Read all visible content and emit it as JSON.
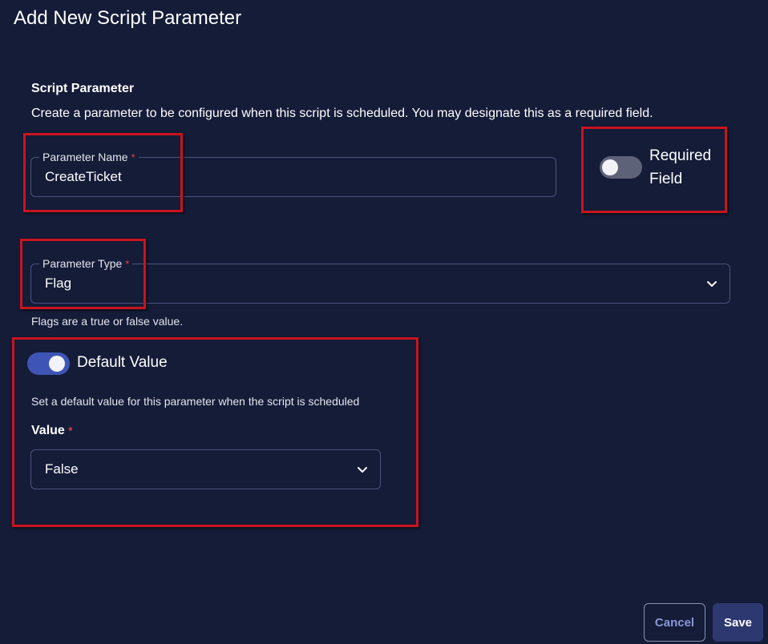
{
  "dialog": {
    "title": "Add New Script Parameter"
  },
  "section": {
    "title": "Script Parameter",
    "description": "Create a parameter to be configured when this script is scheduled. You may designate this as a required field."
  },
  "parameter_name": {
    "label": "Parameter Name",
    "required_mark": "*",
    "value": "CreateTicket"
  },
  "required_field": {
    "label_line1": "Required",
    "label_line2": "Field",
    "enabled": false
  },
  "parameter_type": {
    "label": "Parameter Type",
    "required_mark": "*",
    "selected": "Flag",
    "helper": "Flags are a true or false value.",
    "icon": "chevron-down-icon"
  },
  "default_value": {
    "label": "Default Value",
    "enabled": true,
    "description": "Set a default value for this parameter when the script is scheduled",
    "value_label": "Value",
    "required_mark": "*",
    "selected": "False",
    "icon": "chevron-down-icon"
  },
  "footer": {
    "cancel_label": "Cancel",
    "save_label": "Save"
  },
  "colors": {
    "background": "#141c38",
    "highlight": "#c8141e",
    "toggle_on": "#3e55b5",
    "toggle_off": "#5e6278",
    "required": "#e0404a"
  }
}
